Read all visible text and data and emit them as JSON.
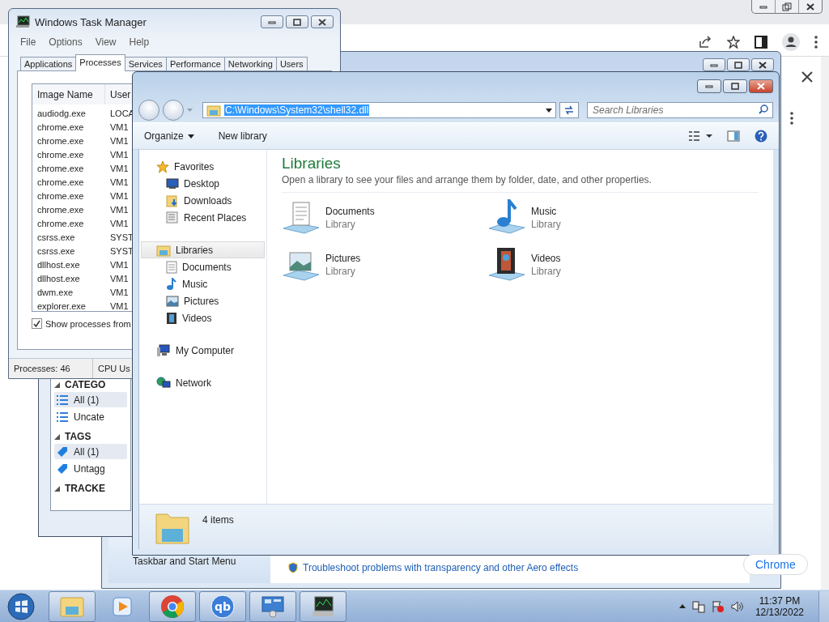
{
  "browser": {
    "chrome_button": "Chrome"
  },
  "control_panel": {
    "side_link": "Taskbar and Start Menu",
    "link": "Troubleshoot problems with transparency and other Aero effects"
  },
  "notes_app": {
    "sections": [
      {
        "title": "CATEGO",
        "items": [
          {
            "label": "All (1)",
            "kind": "list",
            "selected": true
          },
          {
            "label": "Uncate",
            "kind": "list",
            "selected": false
          }
        ]
      },
      {
        "title": "TAGS",
        "items": [
          {
            "label": "All (1)",
            "kind": "tag",
            "selected": true
          },
          {
            "label": "Untagg",
            "kind": "tag",
            "selected": false
          }
        ]
      },
      {
        "title": "TRACKE"
      }
    ]
  },
  "task_manager": {
    "title": "Windows Task Manager",
    "menu": [
      "File",
      "Options",
      "View",
      "Help"
    ],
    "tabs": [
      {
        "label": "Applications",
        "selected": false
      },
      {
        "label": "Processes",
        "selected": true
      },
      {
        "label": "Services",
        "selected": false
      },
      {
        "label": "Performance",
        "selected": false
      },
      {
        "label": "Networking",
        "selected": false
      },
      {
        "label": "Users",
        "selected": false
      }
    ],
    "columns": [
      "Image Name",
      "User"
    ],
    "rows": [
      [
        "audiodg.exe",
        "LOCA"
      ],
      [
        "chrome.exe",
        "VM1"
      ],
      [
        "chrome.exe",
        "VM1"
      ],
      [
        "chrome.exe",
        "VM1"
      ],
      [
        "chrome.exe",
        "VM1"
      ],
      [
        "chrome.exe",
        "VM1"
      ],
      [
        "chrome.exe",
        "VM1"
      ],
      [
        "chrome.exe",
        "VM1"
      ],
      [
        "chrome.exe",
        "VM1"
      ],
      [
        "csrss.exe",
        "SYST"
      ],
      [
        "csrss.exe",
        "SYST"
      ],
      [
        "dllhost.exe",
        "VM1"
      ],
      [
        "dllhost.exe",
        "VM1"
      ],
      [
        "dwm.exe",
        "VM1"
      ],
      [
        "explorer.exe",
        "VM1"
      ]
    ],
    "show_all": {
      "label": "Show processes from",
      "checked": true
    },
    "status": [
      "Processes: 46",
      "CPU Us"
    ]
  },
  "explorer": {
    "address": "C:\\Windows\\System32\\shell32.dll",
    "search": {
      "placeholder": "Search Libraries"
    },
    "commands": [
      "Organize",
      "New library"
    ],
    "nav": [
      {
        "label": "Favorites",
        "kind": "star",
        "selected": false,
        "children": [
          {
            "label": "Desktop",
            "kind": "desktop",
            "selected": false
          },
          {
            "label": "Downloads",
            "kind": "downloads",
            "selected": false
          },
          {
            "label": "Recent Places",
            "kind": "recent",
            "selected": false
          }
        ]
      },
      {
        "label": "Libraries",
        "kind": "libraries",
        "selected": true,
        "children": [
          {
            "label": "Documents",
            "kind": "documents",
            "selected": false
          },
          {
            "label": "Music",
            "kind": "music",
            "selected": false
          },
          {
            "label": "Pictures",
            "kind": "pictures",
            "selected": false
          },
          {
            "label": "Videos",
            "kind": "videos",
            "selected": false
          }
        ]
      },
      {
        "label": "My Computer",
        "kind": "computer",
        "selected": false
      },
      {
        "label": "Network",
        "kind": "network",
        "selected": false
      }
    ],
    "heading": "Libraries",
    "description": "Open a library to see your files and arrange them by folder, date, and other properties.",
    "libraries": [
      {
        "name": "Documents",
        "type": "Library",
        "kind": "documents"
      },
      {
        "name": "Music",
        "type": "Library",
        "kind": "music"
      },
      {
        "name": "Pictures",
        "type": "Library",
        "kind": "pictures"
      },
      {
        "name": "Videos",
        "type": "Library",
        "kind": "videos"
      }
    ],
    "status": "4 items"
  },
  "taskbar": {
    "apps": [
      {
        "kind": "explorer",
        "framed": true
      },
      {
        "kind": "media",
        "framed": false
      },
      {
        "kind": "chrome",
        "framed": true
      },
      {
        "kind": "qbittorrent",
        "framed": true,
        "text": "qb"
      },
      {
        "kind": "control-panel",
        "framed": true
      },
      {
        "kind": "task-manager",
        "framed": true
      }
    ],
    "time": "11:37 PM",
    "date": "12/13/2022"
  }
}
